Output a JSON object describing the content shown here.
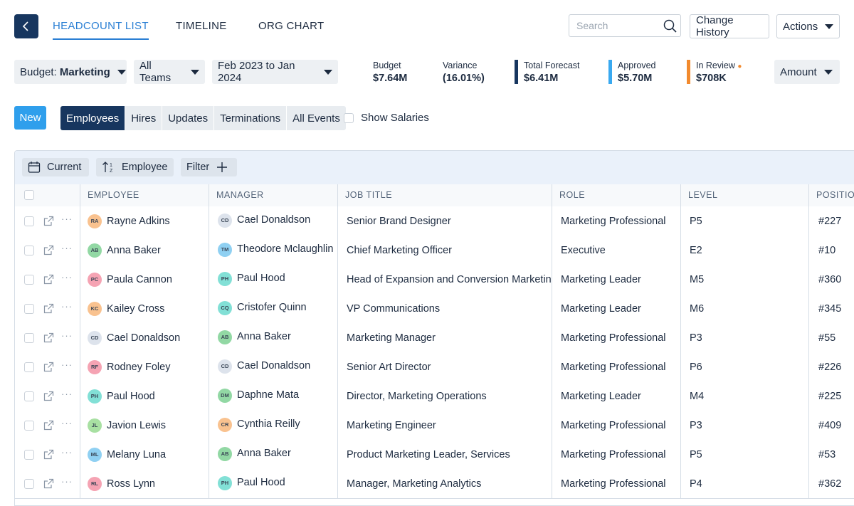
{
  "nav": {
    "tabs": [
      {
        "label": "HEADCOUNT LIST",
        "active": true
      },
      {
        "label": "TIMELINE",
        "active": false
      },
      {
        "label": "ORG CHART",
        "active": false
      }
    ]
  },
  "header": {
    "search_placeholder": "Search",
    "change_history": "Change History",
    "actions": "Actions"
  },
  "filters": {
    "budget_prefix": "Budget:",
    "budget_value": "Marketing",
    "teams": "All Teams",
    "date_range": "Feb 2023 to Jan 2024",
    "amount": "Amount"
  },
  "metrics": [
    {
      "label": "Budget",
      "value": "$7.64M",
      "color": ""
    },
    {
      "label": "Variance",
      "value": "(16.01%)",
      "color": ""
    },
    {
      "label": "Total Forecast",
      "value": "$6.41M",
      "color": "#17365f"
    },
    {
      "label": "Approved",
      "value": "$5.70M",
      "color": "#39a9f0"
    },
    {
      "label": "In Review",
      "value": "$708K",
      "color": "#f28a2e"
    }
  ],
  "actions_row": {
    "new": "New",
    "segments": [
      "Employees",
      "Hires",
      "Updates",
      "Terminations",
      "All Events"
    ],
    "show_salaries": "Show Salaries"
  },
  "toolbar": {
    "current": "Current",
    "sort": "Employee",
    "filter": "Filter"
  },
  "table": {
    "headers": [
      "EMPLOYEE",
      "MANAGER",
      "JOB TITLE",
      "ROLE",
      "LEVEL",
      "POSITION"
    ],
    "rows": [
      {
        "employee": "Rayne Adkins",
        "emp_init": "RA",
        "emp_color": "#f9c28f",
        "manager": "Cael Donaldson",
        "mgr_init": "CD",
        "mgr_color": "#dde3ec",
        "title": "Senior Brand Designer",
        "role": "Marketing Professional",
        "level": "P5",
        "position": "#227"
      },
      {
        "employee": "Anna Baker",
        "emp_init": "AB",
        "emp_color": "#92d8a4",
        "manager": "Theodore Mclaughlin",
        "mgr_init": "TM",
        "mgr_color": "#8fd0f2",
        "title": "Chief Marketing Officer",
        "role": "Executive",
        "level": "E2",
        "position": "#10"
      },
      {
        "employee": "Paula Cannon",
        "emp_init": "PC",
        "emp_color": "#f5a3b3",
        "manager": "Paul Hood",
        "mgr_init": "PH",
        "mgr_color": "#82e0d6",
        "title": "Head of Expansion and Conversion Marketing",
        "role": "Marketing Leader",
        "level": "M5",
        "position": "#360"
      },
      {
        "employee": "Kailey Cross",
        "emp_init": "KC",
        "emp_color": "#f9c28f",
        "manager": "Cristofer Quinn",
        "mgr_init": "CQ",
        "mgr_color": "#82e0d6",
        "title": "VP Communications",
        "role": "Marketing Leader",
        "level": "M6",
        "position": "#345"
      },
      {
        "employee": "Cael Donaldson",
        "emp_init": "CD",
        "emp_color": "#dde3ec",
        "manager": "Anna Baker",
        "mgr_init": "AB",
        "mgr_color": "#92d8a4",
        "title": "Marketing Manager",
        "role": "Marketing Professional",
        "level": "P3",
        "position": "#55"
      },
      {
        "employee": "Rodney Foley",
        "emp_init": "RF",
        "emp_color": "#f5a3b3",
        "manager": "Cael Donaldson",
        "mgr_init": "CD",
        "mgr_color": "#dde3ec",
        "title": "Senior Art Director",
        "role": "Marketing Professional",
        "level": "P6",
        "position": "#226"
      },
      {
        "employee": "Paul Hood",
        "emp_init": "PH",
        "emp_color": "#82e0d6",
        "manager": "Daphne Mata",
        "mgr_init": "DM",
        "mgr_color": "#92d8a4",
        "title": "Director, Marketing Operations",
        "role": "Marketing Leader",
        "level": "M4",
        "position": "#225"
      },
      {
        "employee": "Javion Lewis",
        "emp_init": "JL",
        "emp_color": "#a8e0a2",
        "manager": "Cynthia Reilly",
        "mgr_init": "CR",
        "mgr_color": "#f9c28f",
        "title": "Marketing Engineer",
        "role": "Marketing Professional",
        "level": "P3",
        "position": "#409"
      },
      {
        "employee": "Melany Luna",
        "emp_init": "ML",
        "emp_color": "#8fd0f2",
        "manager": "Anna Baker",
        "mgr_init": "AB",
        "mgr_color": "#92d8a4",
        "title": "Product Marketing Leader, Services",
        "role": "Marketing Professional",
        "level": "P5",
        "position": "#53"
      },
      {
        "employee": "Ross Lynn",
        "emp_init": "RL",
        "emp_color": "#f5a3b3",
        "manager": "Paul Hood",
        "mgr_init": "PH",
        "mgr_color": "#82e0d6",
        "title": "Manager, Marketing Analytics",
        "role": "Marketing Professional",
        "level": "P4",
        "position": "#362"
      }
    ]
  }
}
